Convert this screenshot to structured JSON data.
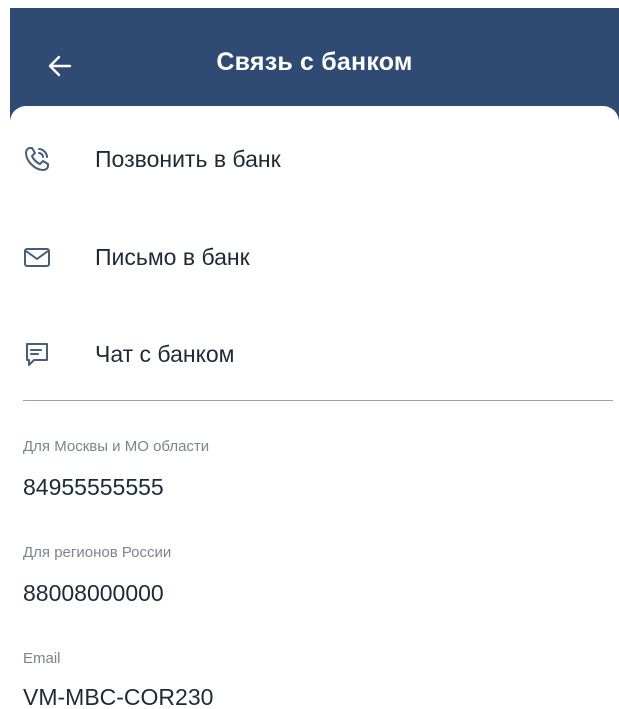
{
  "header": {
    "title": "Связь с банком",
    "back_icon": "arrow-left-icon",
    "background": "#2f4a73"
  },
  "menu": [
    {
      "label": "Позвонить в банк",
      "icon": "phone-icon"
    },
    {
      "label": "Письмо в банк",
      "icon": "envelope-icon"
    },
    {
      "label": "Чат с банком",
      "icon": "chat-icon"
    }
  ],
  "contacts": [
    {
      "caption": "Для Москвы и МО области",
      "value": "84955555555"
    },
    {
      "caption": "Для регионов России",
      "value": "88008000000"
    },
    {
      "caption": "Email",
      "value": "VM-MBC-COR230"
    }
  ],
  "colors": {
    "accent": "#2f4a73",
    "icon": "#4a5d78",
    "text": "#1f2a37",
    "caption": "#7b858f"
  }
}
